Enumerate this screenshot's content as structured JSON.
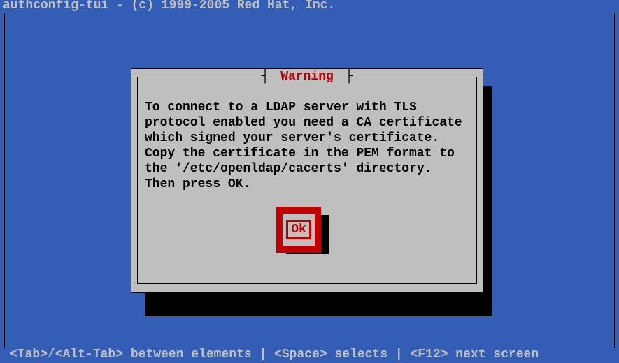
{
  "header": {
    "title": "authconfig-tui - (c) 1999-2005 Red Hat, Inc."
  },
  "dialog": {
    "title": "Warning",
    "message": "To connect to a LDAP server with TLS\nprotocol enabled you need a CA certificate\nwhich signed your server's certificate.\nCopy the certificate in the PEM format to\nthe '/etc/openldap/cacerts' directory.\nThen press OK.",
    "ok_label": "Ok"
  },
  "footer": {
    "hint": "<Tab>/<Alt-Tab> between elements   |   <Space> selects   |  <F12> next screen"
  }
}
